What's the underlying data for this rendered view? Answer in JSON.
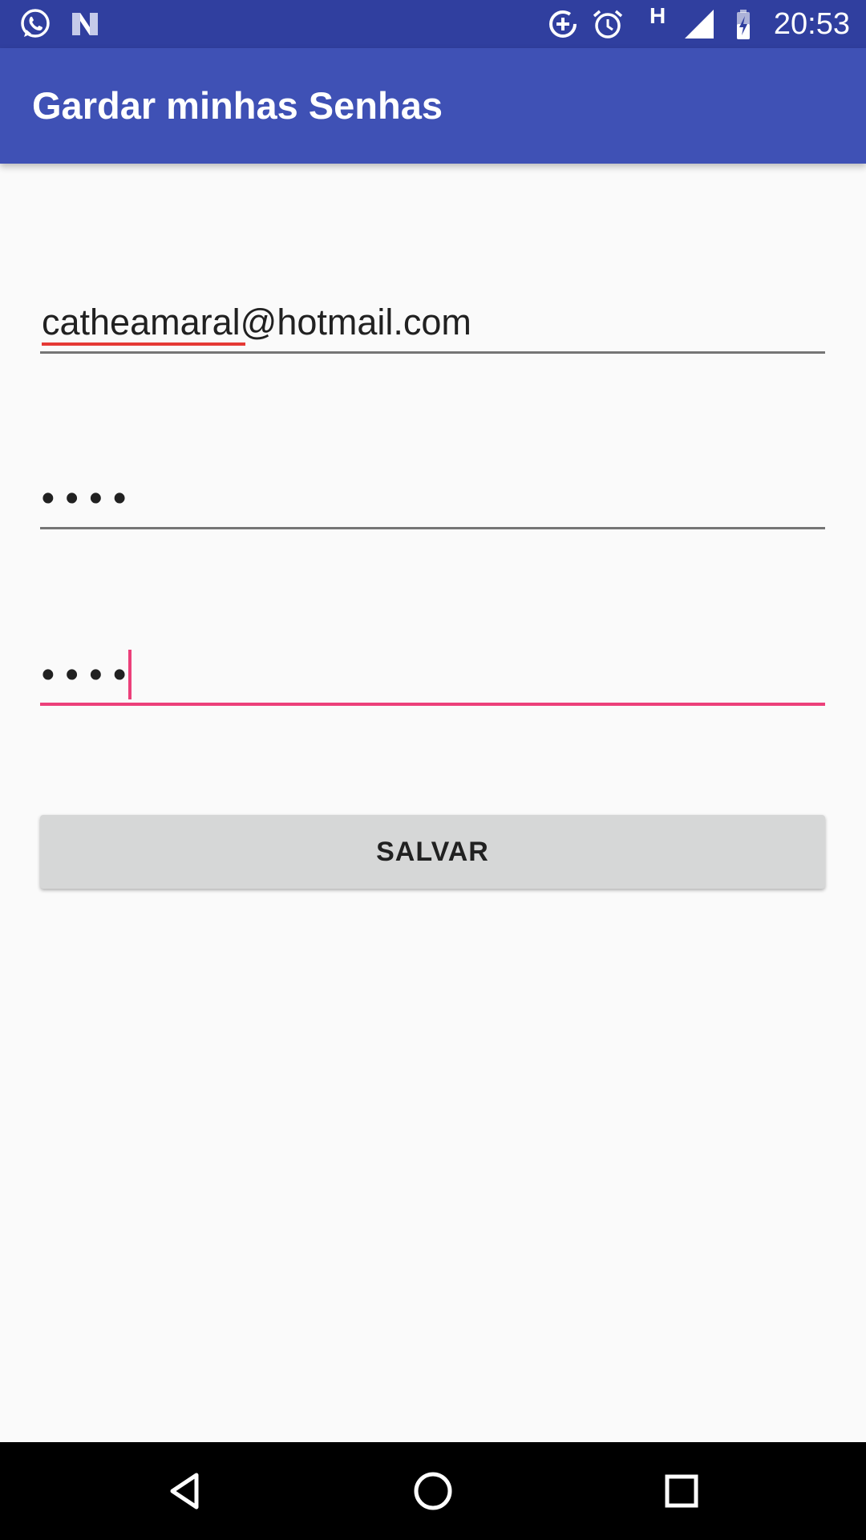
{
  "status_bar": {
    "time": "20:53",
    "network_label": "H",
    "icons": [
      "whatsapp-icon",
      "n-app-icon",
      "data-saver-icon",
      "alarm-icon",
      "signal-icon",
      "battery-charging-icon"
    ]
  },
  "app_bar": {
    "title": "Gardar minhas Senhas"
  },
  "form": {
    "email_value": "catheamaral@hotmail.com",
    "email_misspelled_part": "catheamaral",
    "password_value": "••••",
    "confirm_password_value": "••••",
    "save_label": "SALVAR"
  },
  "colors": {
    "status_bar": "#303f9f",
    "app_bar": "#3f51b5",
    "accent": "#ec407a",
    "button": "#d6d7d7"
  },
  "nav_bar": {
    "icons": [
      "back-icon",
      "home-icon",
      "recents-icon"
    ]
  }
}
